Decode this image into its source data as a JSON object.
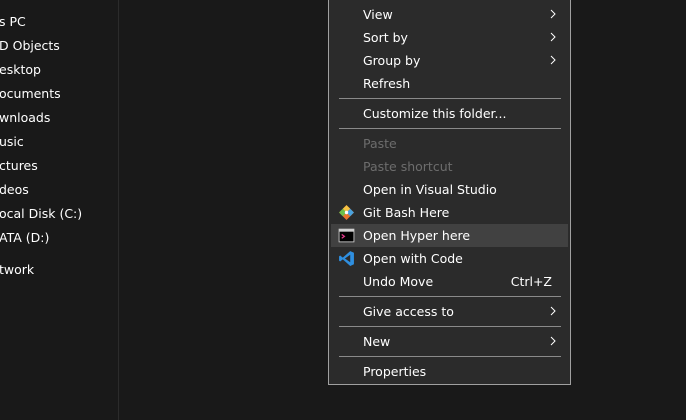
{
  "navigation": {
    "items": [
      {
        "label": "s PC"
      },
      {
        "label": "D Objects"
      },
      {
        "label": "esktop"
      },
      {
        "label": "ocuments"
      },
      {
        "label": "wnloads"
      },
      {
        "label": "usic"
      },
      {
        "label": "ctures"
      },
      {
        "label": "deos"
      },
      {
        "label": "ocal Disk (C:)"
      },
      {
        "label": "ATA (D:)"
      },
      {
        "label": "twork"
      }
    ]
  },
  "context_menu": {
    "view": "View",
    "sort_by": "Sort by",
    "group_by": "Group by",
    "refresh": "Refresh",
    "customize_folder": "Customize this folder...",
    "paste": "Paste",
    "paste_shortcut": "Paste shortcut",
    "open_visual_studio": "Open in Visual Studio",
    "git_bash_here": "Git Bash Here",
    "open_hyper_here": "Open Hyper here",
    "open_with_code": "Open with Code",
    "undo_move": "Undo Move",
    "undo_move_shortcut": "Ctrl+Z",
    "give_access_to": "Give access to",
    "new": "New",
    "properties": "Properties"
  },
  "icons": {
    "git_bash": "git-bash-icon",
    "hyper": "hyper-terminal-icon",
    "vscode": "vscode-icon",
    "submenu": "chevron-right-icon"
  },
  "colors": {
    "background": "#191919",
    "menu_background": "#2b2b2b",
    "menu_border": "#a0a0a0",
    "highlight": "#414141",
    "disabled_text": "#6d6d6d",
    "vscode_blue": "#2f8fe0",
    "git_orange": "#e8742c"
  }
}
